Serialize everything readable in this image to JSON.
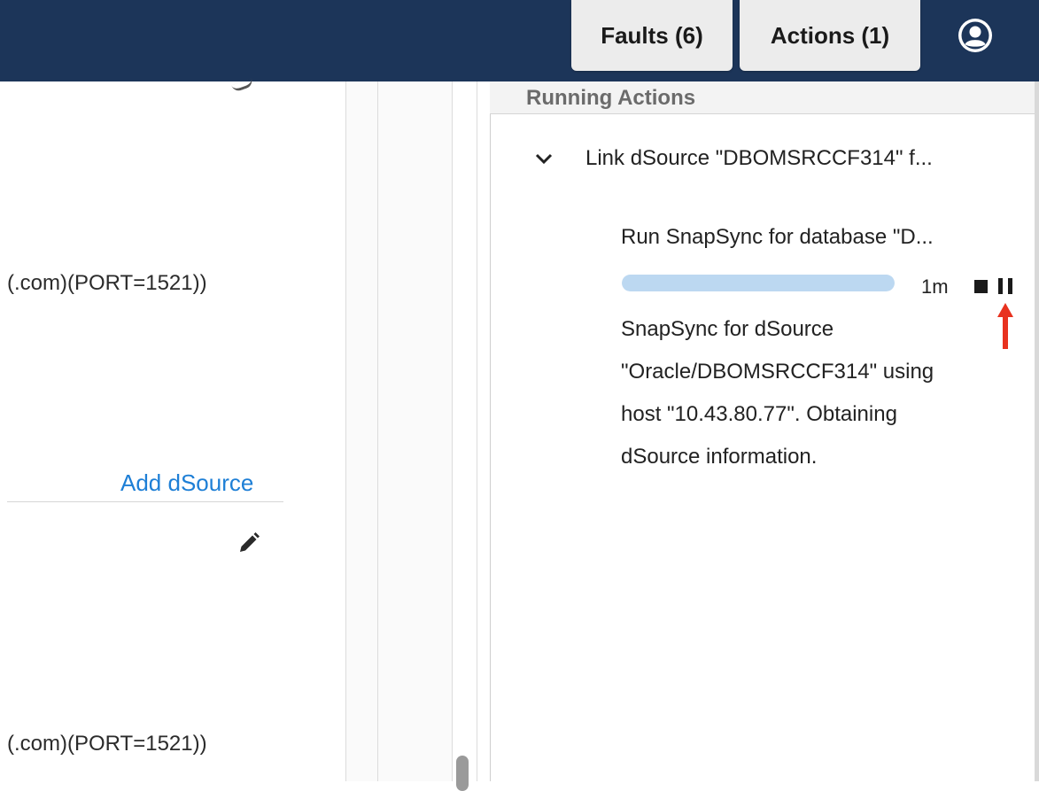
{
  "header": {
    "faults_label": "Faults (6)",
    "actions_label": "Actions (1)",
    "user_icon": "user-circle-icon"
  },
  "left_panel": {
    "connection_line_1": "(.com)(PORT=1521))",
    "add_dsource_label": "Add dSource",
    "edit_icon": "pencil-icon",
    "connection_line_2": "(.com)(PORT=1521))"
  },
  "running_actions": {
    "title": "Running Actions",
    "action": {
      "title": "Link dSource \"DBOMSRCCF314\" f...",
      "subtask": {
        "title": "Run SnapSync for database \"D...",
        "progress": 1.0,
        "elapsed": "1m",
        "description_lines": [
          "SnapSync for dSource",
          "\"Oracle/DBOMSRCCF314\" using",
          "host \"10.43.80.77\". Obtaining",
          "dSource information."
        ]
      }
    }
  },
  "colors": {
    "header_bg": "#1c3559",
    "link": "#1e7fd6",
    "progress": "#bcd8f1",
    "annotation_arrow": "#e8321f"
  }
}
